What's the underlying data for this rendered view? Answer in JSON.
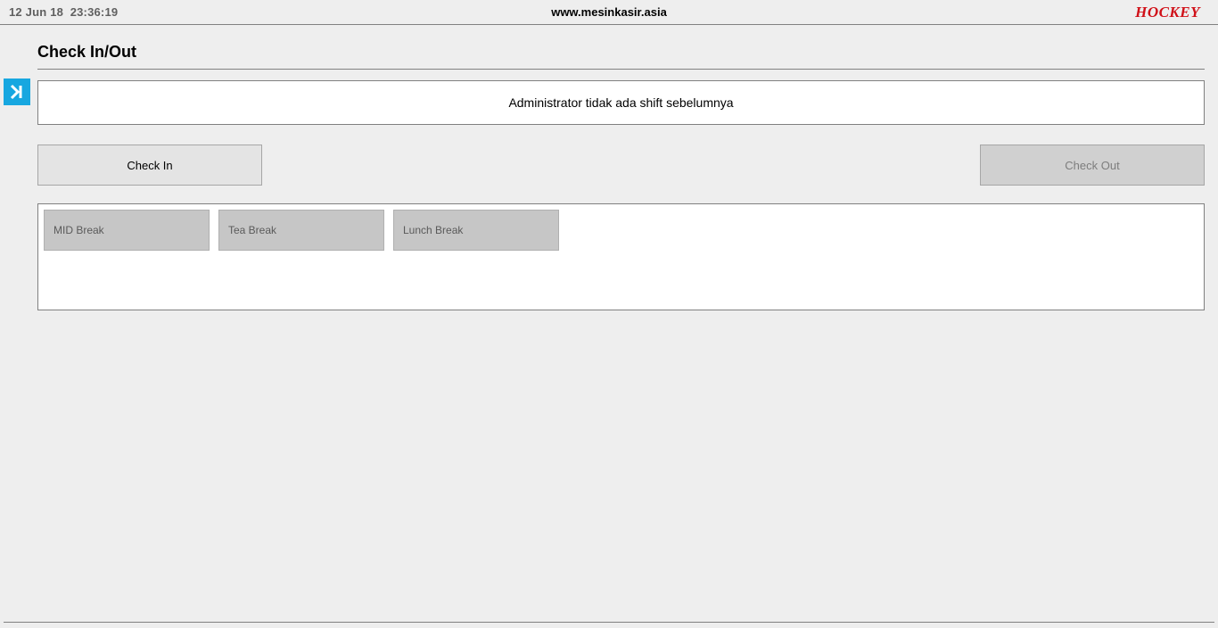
{
  "header": {
    "date": "12 Jun 18",
    "time": "23:36:19",
    "site": "www.mesinkasir.asia",
    "brand": "HOCKEY"
  },
  "page": {
    "title": "Check In/Out"
  },
  "message": "Administrator tidak ada shift sebelumnya",
  "buttons": {
    "check_in": "Check In",
    "check_out": "Check Out"
  },
  "breaks": [
    "MID Break",
    "Tea Break",
    "Lunch Break"
  ]
}
